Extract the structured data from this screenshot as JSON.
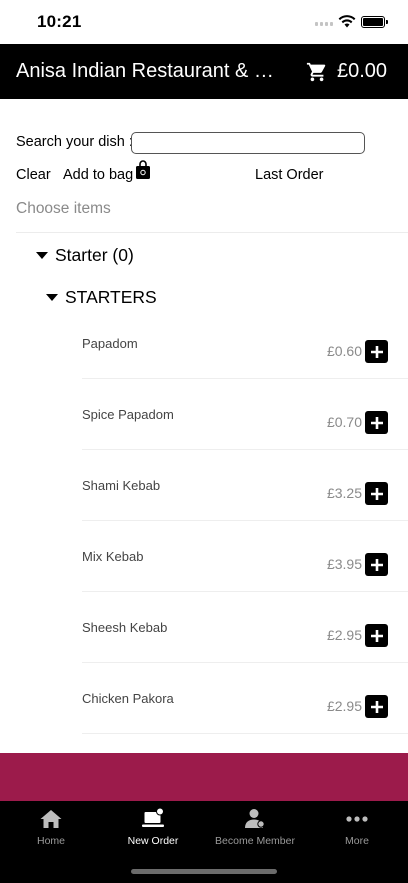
{
  "status_bar": {
    "time": "10:21"
  },
  "header": {
    "title": "Anisa Indian Restaurant & …",
    "cart_total": "£0.00"
  },
  "search": {
    "label": "Search your dish :",
    "value": "",
    "placeholder": ""
  },
  "actions": {
    "clear": "Clear",
    "add_to_bag": "Add to bag",
    "last_order": "Last Order"
  },
  "choose_items": "Choose items",
  "category": {
    "label": "Starter (0)"
  },
  "subcategory": {
    "label": "STARTERS"
  },
  "menu_items": [
    {
      "name": "Papadom",
      "price": "£0.60"
    },
    {
      "name": "Spice Papadom",
      "price": "£0.70"
    },
    {
      "name": "Shami Kebab",
      "price": "£3.25"
    },
    {
      "name": "Mix Kebab",
      "price": "£3.95"
    },
    {
      "name": "Sheesh Kebab",
      "price": "£2.95"
    },
    {
      "name": "Chicken Pakora",
      "price": "£2.95"
    }
  ],
  "tabbar": {
    "home": "Home",
    "new_order": "New Order",
    "become_member": "Become Member",
    "more": "More"
  },
  "colors": {
    "header_bg": "#000000",
    "promo_band": "#9c1b4b",
    "tabbar_bg": "#000000"
  },
  "icons": [
    "cart-icon",
    "bag-icon",
    "plus-icon",
    "home-icon",
    "laptop-icon",
    "person-icon",
    "more-icon",
    "wifi-icon",
    "battery-icon"
  ]
}
